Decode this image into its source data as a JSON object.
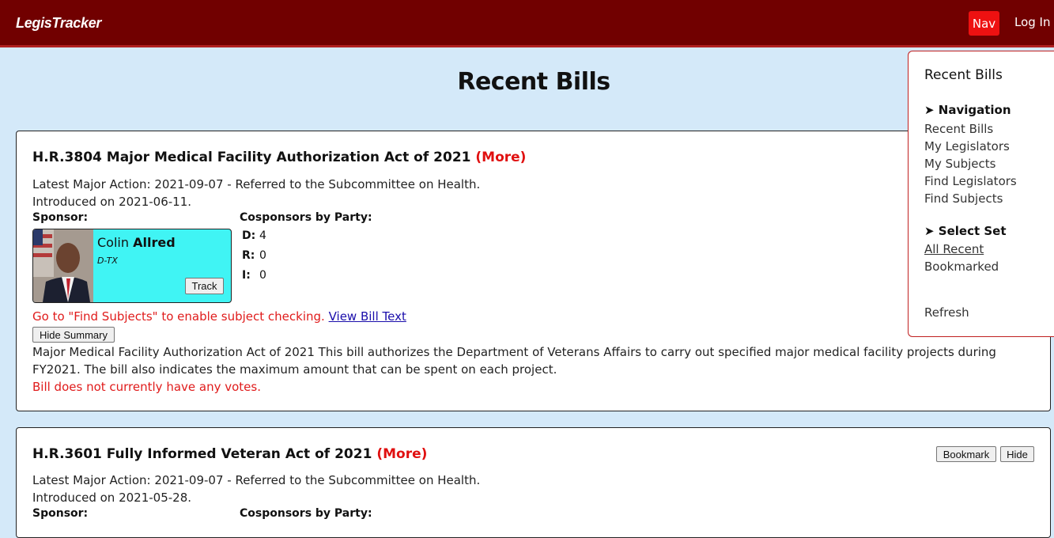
{
  "header": {
    "brand": "LegisTracker",
    "nav_label": "Nav",
    "login_label": "Log In"
  },
  "page_title": "Recent Bills",
  "bills": [
    {
      "title": "H.R.3804 Major Medical Facility Authorization Act of 2021",
      "more_label": "(More)",
      "latest_action": "Latest Major Action: 2021-09-07 - Referred to the Subcommittee on Health.",
      "introduced": "Introduced on 2021-06-11.",
      "sponsor_label": "Sponsor:",
      "cosponsors_label": "Cosponsors by Party:",
      "sponsor": {
        "first": "Colin",
        "last": "Allred",
        "party": "D-TX",
        "track_label": "Track"
      },
      "cosponsors": [
        {
          "party": "D:",
          "count": "4"
        },
        {
          "party": "R:",
          "count": "0"
        },
        {
          "party": "I:",
          "count": "0"
        }
      ],
      "subject_notice": "Go to \"Find Subjects\" to enable subject checking.",
      "view_text_label": "View Bill Text",
      "hide_summary_label": "Hide Summary",
      "summary": "Major Medical Facility Authorization Act of 2021 This bill authorizes the Department of Veterans Affairs to carry out specified major medical facility projects during FY2021. The bill also indicates the maximum amount that can be spent on each project.",
      "votes_notice": "Bill does not currently have any votes."
    },
    {
      "title": "H.R.3601 Fully Informed Veteran Act of 2021",
      "more_label": "(More)",
      "latest_action": "Latest Major Action: 2021-09-07 - Referred to the Subcommittee on Health.",
      "introduced": "Introduced on 2021-05-28.",
      "sponsor_label": "Sponsor:",
      "cosponsors_label": "Cosponsors by Party:",
      "bookmark_label": "Bookmark",
      "hide_label": "Hide"
    }
  ],
  "nav_menu": {
    "heading": "Recent Bills",
    "navigation_title": "➤ Navigation",
    "navigation_items": [
      "Recent Bills",
      "My Legislators",
      "My Subjects",
      "Find Legislators",
      "Find Subjects"
    ],
    "select_set_title": "➤ Select Set",
    "select_set_items": [
      "All Recent",
      "Bookmarked"
    ],
    "refresh_label": "Refresh"
  },
  "colors": {
    "header_bg": "#710000",
    "nav_button": "#ee1111",
    "page_bg": "#d4e9f9",
    "sponsor_card": "#40f4f4",
    "alert_red": "#e01b1b"
  }
}
